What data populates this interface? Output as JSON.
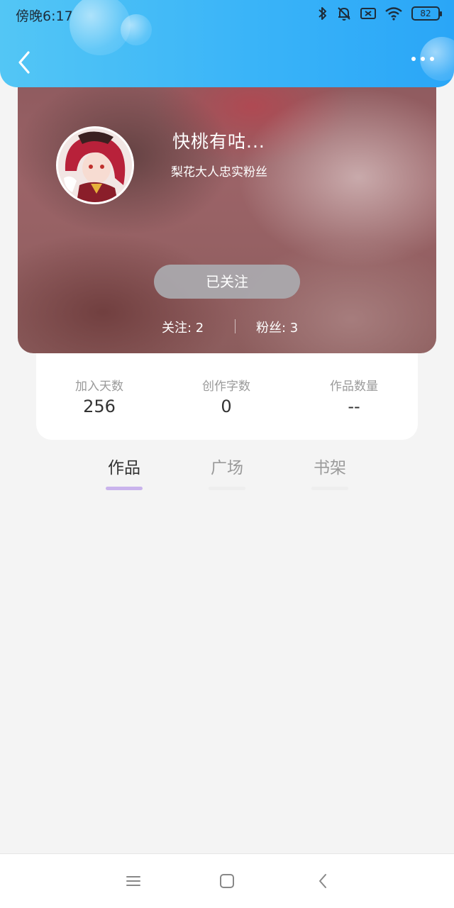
{
  "status_bar": {
    "time": "傍晚6:17",
    "battery": "82",
    "icons": [
      "bluetooth-icon",
      "bell-muted-icon",
      "sim-off-icon",
      "wifi-icon",
      "battery-icon"
    ]
  },
  "header": {
    "back_icon": "chevron-left-icon",
    "more_icon": "more-dots-icon",
    "accent": "#3ab4f8"
  },
  "profile": {
    "nickname": "快桃有咕...",
    "signature": "梨花大人忠实粉丝",
    "follow_label": "已关注",
    "following": "关注: 2",
    "fans": "粉丝: 3"
  },
  "info": [
    {
      "label": "加入天数",
      "value": "256"
    },
    {
      "label": "创作字数",
      "value": "0"
    },
    {
      "label": "作品数量",
      "value": "--"
    }
  ],
  "tabs": [
    {
      "label": "作品",
      "active": true
    },
    {
      "label": "广场",
      "active": false
    },
    {
      "label": "书架",
      "active": false
    }
  ],
  "tab_indicator_color": "#c9b3ec",
  "nav": {
    "icons": [
      "menu-icon",
      "home-square-icon",
      "back-chevron-icon"
    ]
  }
}
